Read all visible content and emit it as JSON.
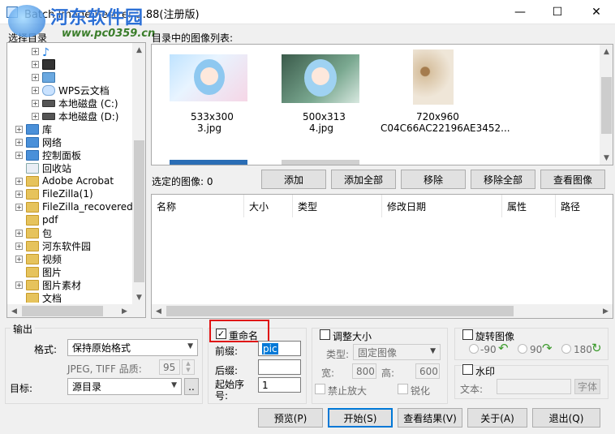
{
  "window": {
    "title": "Batch Image Resizer 2.88(注册版)",
    "minimize": "—",
    "maximize": "☐",
    "close": "✕"
  },
  "watermark": {
    "line1": "河东软件园",
    "line2": "www.pc0359.cn"
  },
  "tree": {
    "label": "选择目录",
    "items": [
      {
        "name": "",
        "icon": "music-folder-icon"
      },
      {
        "name": "",
        "icon": "video-folder-icon"
      },
      {
        "name": "",
        "icon": "pictures-folder-icon"
      },
      {
        "name": "WPS云文档",
        "icon": "cloud-icon"
      },
      {
        "name": "本地磁盘 (C:)",
        "icon": "drive-icon"
      },
      {
        "name": "本地磁盘 (D:)",
        "icon": "drive-icon"
      },
      {
        "name": "库",
        "icon": "library-icon"
      },
      {
        "name": "网络",
        "icon": "network-icon"
      },
      {
        "name": "控制面板",
        "icon": "control-panel-icon"
      },
      {
        "name": "回收站",
        "icon": "recycle-bin-icon"
      },
      {
        "name": "Adobe Acrobat",
        "icon": "folder-icon"
      },
      {
        "name": "FileZilla(1)",
        "icon": "folder-icon"
      },
      {
        "name": "FileZilla_recovered",
        "icon": "folder-icon"
      },
      {
        "name": "pdf",
        "icon": "folder-icon"
      },
      {
        "name": "包",
        "icon": "folder-icon"
      },
      {
        "name": "河东软件园",
        "icon": "folder-icon"
      },
      {
        "name": "视频",
        "icon": "folder-icon"
      },
      {
        "name": "图片",
        "icon": "folder-icon"
      },
      {
        "name": "图片素材",
        "icon": "folder-icon"
      },
      {
        "name": "文档",
        "icon": "folder-icon"
      }
    ]
  },
  "gallery": {
    "label": "目录中的图像列表:",
    "items": [
      {
        "size": "533x300",
        "name": "3.jpg"
      },
      {
        "size": "500x313",
        "name": "4.jpg"
      },
      {
        "size": "720x960",
        "name": "C04C66AC22196AE3452..."
      }
    ]
  },
  "selected": {
    "label": "选定的图像: 0",
    "buttons": {
      "add": "添加",
      "add_all": "添加全部",
      "remove": "移除",
      "remove_all": "移除全部",
      "view": "查看图像"
    },
    "columns": [
      "名称",
      "大小",
      "类型",
      "修改日期",
      "属性",
      "路径"
    ]
  },
  "output": {
    "label": "输出",
    "format_label": "格式:",
    "format_value": "保持原始格式",
    "quality_label": "JPEG, TIFF 品质:",
    "quality_value": "95",
    "target_label": "目标:",
    "target_value": "源目录",
    "browse": ".."
  },
  "rename": {
    "label": "重命名",
    "checked": true,
    "prefix_label": "前缀:",
    "prefix_value": "pic",
    "suffix_label": "后缀:",
    "suffix_value": "",
    "start_label": "起始序号:",
    "start_value": "1"
  },
  "resize": {
    "label": "调整大小",
    "type_label": "类型:",
    "type_value": "固定图像",
    "width_label": "宽:",
    "width_value": "800",
    "height_label": "高:",
    "height_value": "600",
    "no_enlarge": "禁止放大",
    "sharpen": "锐化"
  },
  "rotate": {
    "label": "旋转图像",
    "opt1": "-90",
    "opt2": "90",
    "opt3": "180"
  },
  "watermark_opt": {
    "label": "水印",
    "text_label": "文本:",
    "font_btn": "字体"
  },
  "actions": {
    "preview": "预览(P)",
    "start": "开始(S)",
    "view_result": "查看结果(V)",
    "about": "关于(A)",
    "exit": "退出(Q)"
  },
  "colors": {
    "highlight": "#e01010",
    "accent": "#0078d7"
  }
}
